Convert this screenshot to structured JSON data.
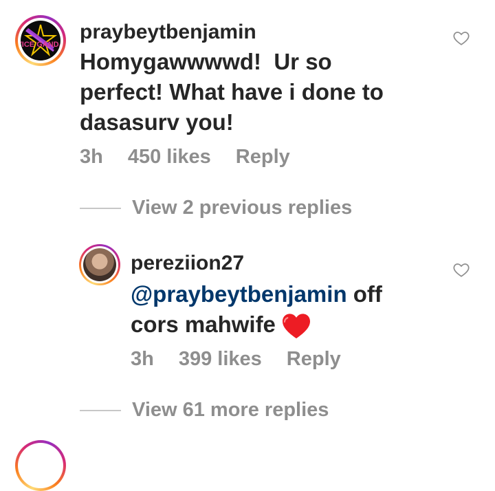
{
  "comments": [
    {
      "username": "praybeytbenjamin",
      "avatar_text": "VICE GANDA",
      "text_lines": [
        "Homygawwwwd!  Ur so",
        "perfect! What have i done to",
        "dasasurv you!"
      ],
      "time": "3h",
      "likes": "450 likes",
      "reply_label": "Reply",
      "like_icon": "heart-outline-icon"
    }
  ],
  "thread": {
    "view_previous_label": "View 2 previous replies",
    "reply": {
      "username": "pereziion27",
      "mention": "@praybeytbenjamin",
      "text_after_mention": " off",
      "line2": "cors mahwife",
      "emoji": "red-heart-emoji",
      "time": "3h",
      "likes": "399 likes",
      "reply_label": "Reply",
      "like_icon": "heart-outline-icon"
    },
    "view_more_label": "View 61 more replies"
  },
  "colors": {
    "text": "#262626",
    "muted": "#8e8e8e",
    "mention": "#00376b",
    "heart_red": "#ed4956"
  }
}
